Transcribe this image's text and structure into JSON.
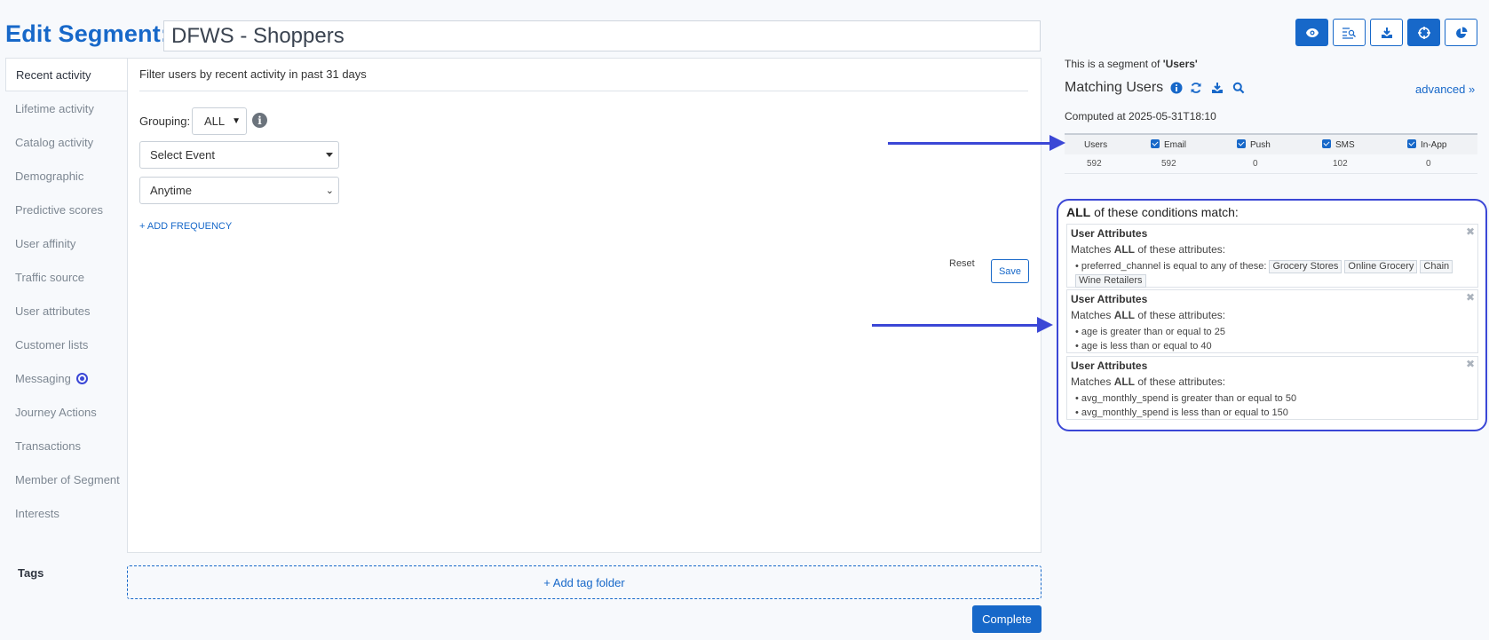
{
  "header": {
    "title": "Edit Segment:",
    "segment_name": "DFWS - Shoppers"
  },
  "tabs": [
    {
      "label": "Recent activity",
      "active": true
    },
    {
      "label": "Lifetime activity"
    },
    {
      "label": "Catalog activity"
    },
    {
      "label": "Demographic"
    },
    {
      "label": "Predictive scores"
    },
    {
      "label": "User affinity"
    },
    {
      "label": "Traffic source"
    },
    {
      "label": "User attributes"
    },
    {
      "label": "Customer lists"
    },
    {
      "label": "Messaging"
    },
    {
      "label": "Journey Actions"
    },
    {
      "label": "Transactions"
    },
    {
      "label": "Member of Segment"
    },
    {
      "label": "Interests"
    }
  ],
  "filter": {
    "heading": "Filter users by recent activity in past 31 days",
    "grouping_label": "Grouping:",
    "grouping_value": "ALL",
    "event_select": "Select Event",
    "time_select": "Anytime",
    "add_frequency": "+ ADD FREQUENCY",
    "reset_label": "Reset",
    "save_label": "Save"
  },
  "tags": {
    "label": "Tags",
    "add_folder": "+ Add tag folder"
  },
  "complete_label": "Complete",
  "toolbar": {
    "icons": [
      "eye-icon",
      "list-search-icon",
      "download-icon",
      "crosshair-icon",
      "pie-chart-icon"
    ],
    "accent": "#1768c9"
  },
  "side": {
    "segment_of_prefix": "This is a segment of ",
    "segment_of_target": "'Users'",
    "matching_title": "Matching Users",
    "advanced": "advanced »",
    "computed": "Computed at 2025-05-31T18:10",
    "stats_headers": [
      "Users",
      "Email",
      "Push",
      "SMS",
      "In-App"
    ],
    "stats_values": [
      "592",
      "592",
      "0",
      "102",
      "0"
    ]
  },
  "conditions": {
    "title_bold": "ALL",
    "title_rest": " of these conditions match:",
    "cards": [
      {
        "title": "User Attributes",
        "match_prefix": "Matches ",
        "match_bold": "ALL",
        "match_suffix": " of these attributes:",
        "line1": "• preferred_channel is equal to any of these:",
        "chips": [
          "Grocery Stores",
          "Online Grocery",
          "Chain",
          "Wine Retailers"
        ]
      },
      {
        "title": "User Attributes",
        "match_prefix": "Matches ",
        "match_bold": "ALL",
        "match_suffix": " of these attributes:",
        "line1": "• age is greater than or equal to 25",
        "line2": "• age is less than or equal to 40"
      },
      {
        "title": "User Attributes",
        "match_prefix": "Matches ",
        "match_bold": "ALL",
        "match_suffix": " of these attributes:",
        "line1": "• avg_monthly_spend is greater than or equal to 50",
        "line2": "• avg_monthly_spend is less than or equal to 150"
      }
    ]
  },
  "colors": {
    "primary": "#1768c9",
    "annotation": "#3b47d6"
  }
}
